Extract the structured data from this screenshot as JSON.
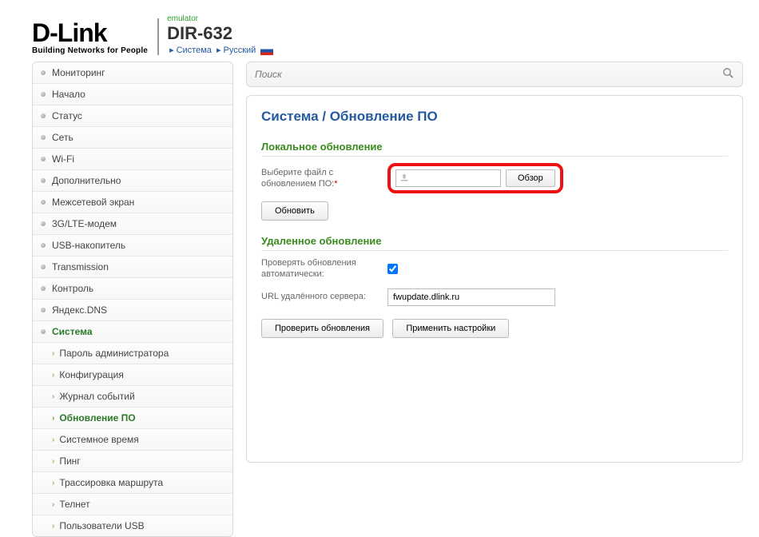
{
  "header": {
    "logo_text": "D-Link",
    "logo_sub": "Building Networks for People",
    "emulator": "emulator",
    "model": "DIR-632",
    "crumb1": "Система",
    "crumb2": "Русский"
  },
  "search": {
    "placeholder": "Поиск"
  },
  "sidebar": {
    "items": [
      "Мониторинг",
      "Начало",
      "Статус",
      "Сеть",
      "Wi-Fi",
      "Дополнительно",
      "Межсетевой экран",
      "3G/LTE-модем",
      "USB-накопитель",
      "Transmission",
      "Контроль",
      "Яндекс.DNS",
      "Система"
    ],
    "sub": [
      "Пароль администратора",
      "Конфигурация",
      "Журнал событий",
      "Обновление ПО",
      "Системное время",
      "Пинг",
      "Трассировка маршрута",
      "Телнет",
      "Пользователи USB"
    ]
  },
  "page": {
    "title": "Система /  Обновление ПО",
    "local": {
      "heading": "Локальное обновление",
      "label": "Выберите файл с обновлением ПО:",
      "browse": "Обзор",
      "update": "Обновить"
    },
    "remote": {
      "heading": "Удаленное обновление",
      "auto_label": "Проверять обновления автоматически:",
      "url_label": "URL удалённого сервера:",
      "url_value": "fwupdate.dlink.ru",
      "check_btn": "Проверить обновления",
      "apply_btn": "Применить настройки"
    }
  }
}
